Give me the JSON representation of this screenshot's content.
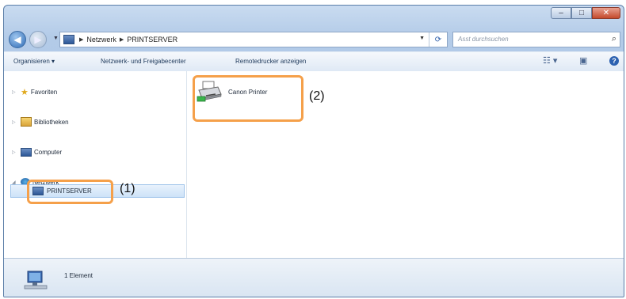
{
  "window": {
    "breadcrumb": [
      "Netzwerk",
      "PRINTSERVER"
    ],
    "search_placeholder": "Asst durchsuchen",
    "caption": {
      "minimize": "–",
      "maximize": "□",
      "close": "✕"
    }
  },
  "toolbar": {
    "organize": "Organisieren ▾",
    "network_center": "Netzwerk- und Freigabecenter",
    "remote_printers": "Remotedrucker anzeigen",
    "view_icon": "view-options-icon",
    "help": "?"
  },
  "nav": {
    "items": [
      {
        "label": "Favoriten",
        "icon": "star-icon"
      },
      {
        "label": "Bibliotheken",
        "icon": "library-icon"
      },
      {
        "label": "Computer",
        "icon": "computer-icon"
      },
      {
        "label": "Netzwerk",
        "icon": "network-icon"
      }
    ],
    "selected": "PRINTSERVER"
  },
  "content": {
    "items": [
      {
        "label": "Canon Printer",
        "icon": "printer-icon"
      }
    ]
  },
  "callouts": {
    "one": "(1)",
    "two": "(2)"
  },
  "status": {
    "count": "1 Element"
  },
  "colors": {
    "callout": "#f5a04a",
    "selection": "#cde3f8"
  }
}
